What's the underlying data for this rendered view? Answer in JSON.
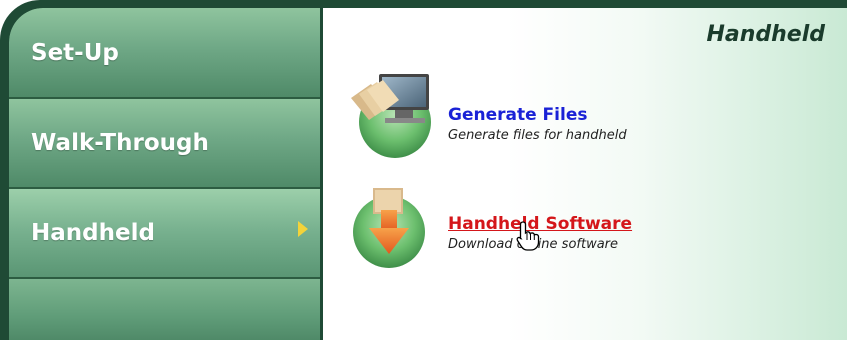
{
  "sidebar": {
    "items": [
      {
        "label": "Set-Up"
      },
      {
        "label": "Walk-Through"
      },
      {
        "label": "Handheld"
      }
    ]
  },
  "main": {
    "title": "Handheld",
    "items": [
      {
        "title": "Generate Files",
        "description": "Generate files for handheld",
        "icon": "monitor-files-icon"
      },
      {
        "title": "Handheld Software",
        "description": "Download offline software",
        "icon": "download-box-icon"
      }
    ]
  },
  "colors": {
    "frame": "#1f4a35",
    "nav_green": "#6fa886",
    "link_blue": "#1a22d6",
    "link_red": "#d4161a",
    "active_arrow": "#f3d33a"
  }
}
